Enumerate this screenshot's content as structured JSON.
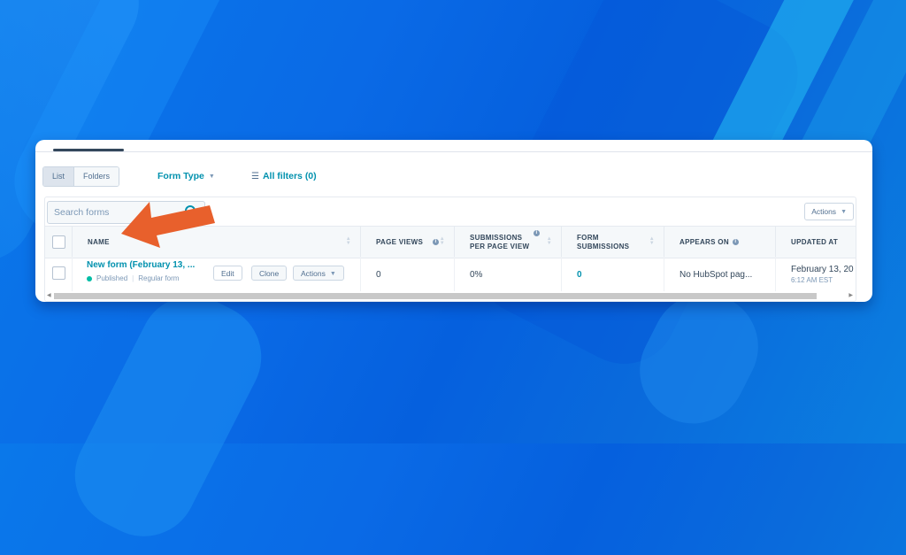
{
  "toolbar": {
    "view_toggle": [
      "List",
      "Folders"
    ],
    "form_type_label": "Form Type",
    "all_filters_label": "All filters (0)"
  },
  "search": {
    "placeholder": "Search forms"
  },
  "table_actions_label": "Actions",
  "table": {
    "columns": [
      {
        "label": "NAME"
      },
      {
        "label": "PAGE VIEWS"
      },
      {
        "label": "SUBMISSIONS PER PAGE VIEW"
      },
      {
        "label": "FORM SUBMISSIONS"
      },
      {
        "label": "APPEARS ON"
      },
      {
        "label": "UPDATED AT"
      }
    ],
    "rows": [
      {
        "name": "New form (February 13, ...",
        "status": "Published",
        "type": "Regular form",
        "edit_label": "Edit",
        "clone_label": "Clone",
        "actions_label": "Actions",
        "page_views": "0",
        "submissions_per_view": "0%",
        "form_submissions": "0",
        "appears_on": "No HubSpot pag...",
        "updated_date": "February 13, 20",
        "updated_time": "6:12 AM EST"
      }
    ]
  },
  "colors": {
    "accent": "#0091ae",
    "status_published": "#00bda5",
    "arrow": "#e8602c",
    "background": "#0a6ae6"
  }
}
